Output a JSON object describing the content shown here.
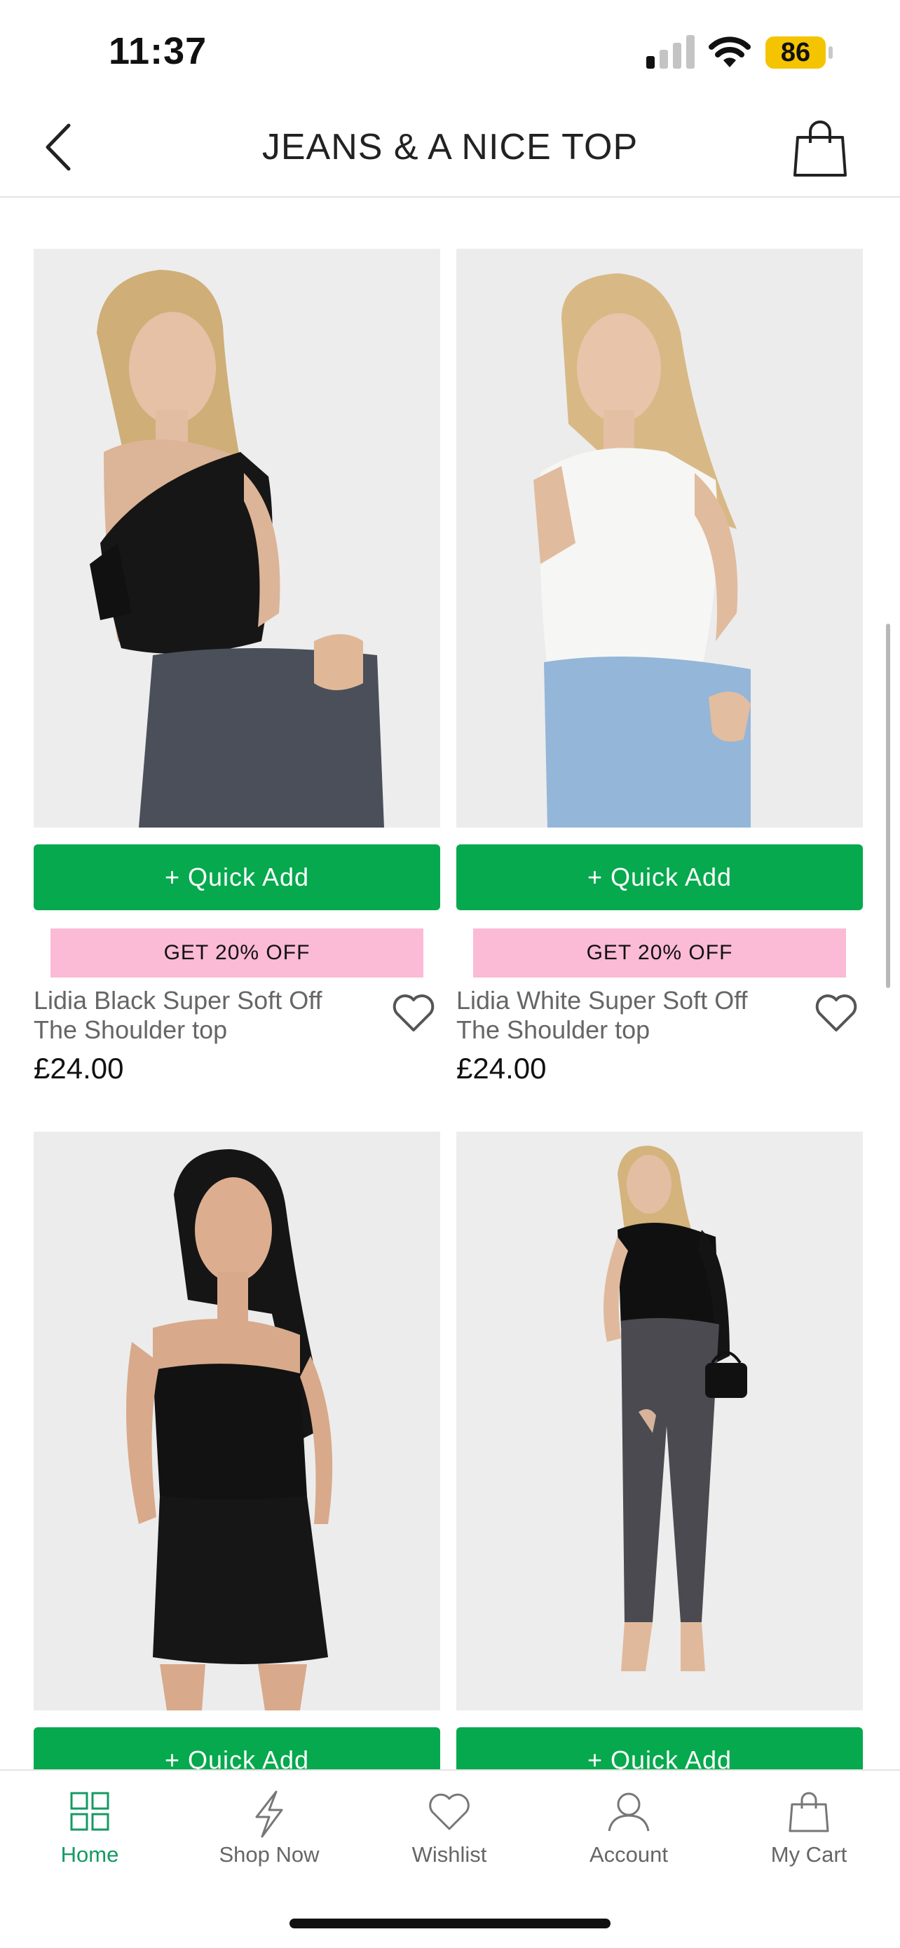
{
  "status": {
    "time": "11:37",
    "battery": "86"
  },
  "nav": {
    "title": "JEANS & A NICE TOP"
  },
  "products": [
    {
      "name": "Lidia Black Super Soft Off The Shoulder top",
      "price": "£24.00",
      "quick_add": "+ Quick Add",
      "promo": "GET 20% OFF",
      "image": "model-black-off-shoulder-top"
    },
    {
      "name": "Lidia White Super Soft Off The Shoulder top",
      "price": "£24.00",
      "quick_add": "+ Quick Add",
      "promo": "GET 20% OFF",
      "image": "model-white-off-shoulder-top"
    },
    {
      "quick_add": "+ Quick Add",
      "image": "model-black-bandeau-skort-set"
    },
    {
      "quick_add": "+ Quick Add",
      "image": "model-black-one-shoulder-bodysuit-jeans"
    }
  ],
  "tabs": [
    {
      "label": "Home",
      "icon": "grid-icon",
      "active": true
    },
    {
      "label": "Shop Now",
      "icon": "lightning-icon"
    },
    {
      "label": "Wishlist",
      "icon": "heart-icon"
    },
    {
      "label": "Account",
      "icon": "person-icon"
    },
    {
      "label": "My Cart",
      "icon": "bag-icon"
    }
  ],
  "colors": {
    "accent_green": "#06a94d",
    "promo_pink": "#fbbad6",
    "active_tab": "#149a62"
  }
}
